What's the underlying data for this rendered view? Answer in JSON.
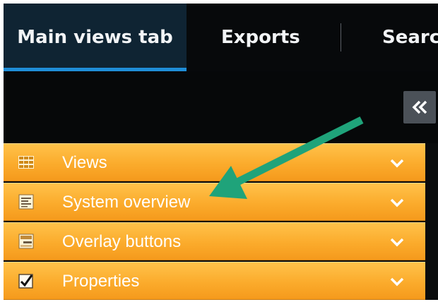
{
  "tabs": {
    "main_views": "Main views tab",
    "exports": "Exports",
    "search": "Searc"
  },
  "collapse_button": {
    "icon": "double-chevron-left-icon",
    "glyph": "«"
  },
  "panels": [
    {
      "label": "Views",
      "icon": "grid-icon"
    },
    {
      "label": "System overview",
      "icon": "document-list-icon"
    },
    {
      "label": "Overlay buttons",
      "icon": "overlay-icon"
    },
    {
      "label": "Properties",
      "icon": "checkbox-icon"
    }
  ],
  "annotation": {
    "type": "arrow",
    "color": "#1fa37a",
    "points_to": "System overview"
  },
  "colors": {
    "background": "#060809",
    "active_tab": "#0f2433",
    "tab_underline": "#1f8ed8",
    "panel_orange": "#fbab2c",
    "collapse_button": "#4b5158"
  }
}
